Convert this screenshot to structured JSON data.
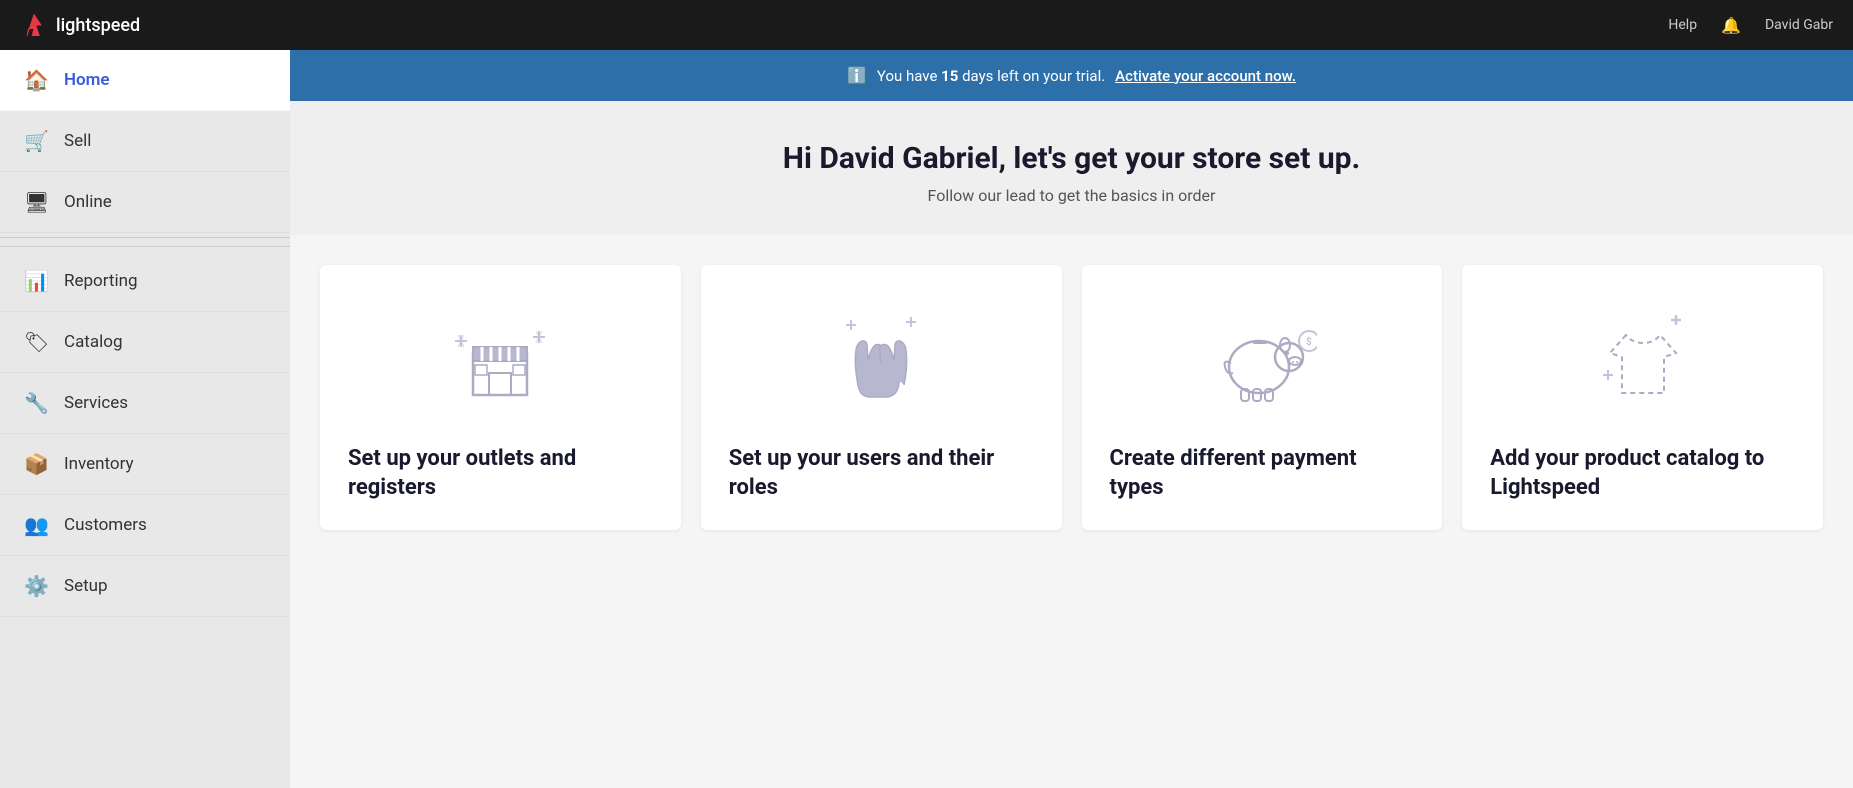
{
  "topbar": {
    "logo_text": "lightspeed",
    "help_label": "Help",
    "user_label": "David Gabr"
  },
  "trial_banner": {
    "message_prefix": "You have ",
    "days": "15",
    "message_suffix": " days left on your trial.",
    "activate_link": "Activate your account now."
  },
  "welcome": {
    "title": "Hi David Gabriel, let's get your store set up.",
    "subtitle": "Follow our lead to get the basics in order"
  },
  "sidebar": {
    "items": [
      {
        "id": "home",
        "label": "Home",
        "icon": "🏠",
        "active": true
      },
      {
        "id": "sell",
        "label": "Sell",
        "icon": "🛒",
        "active": false
      },
      {
        "id": "online",
        "label": "Online",
        "icon": "🖥",
        "active": false
      },
      {
        "id": "reporting",
        "label": "Reporting",
        "icon": "📊",
        "active": false
      },
      {
        "id": "catalog",
        "label": "Catalog",
        "icon": "🏷",
        "active": false
      },
      {
        "id": "services",
        "label": "Services",
        "icon": "🔧",
        "active": false
      },
      {
        "id": "inventory",
        "label": "Inventory",
        "icon": "📦",
        "active": false
      },
      {
        "id": "customers",
        "label": "Customers",
        "icon": "👥",
        "active": false
      },
      {
        "id": "setup",
        "label": "Setup",
        "icon": "⚙️",
        "active": false
      }
    ]
  },
  "cards": [
    {
      "id": "outlets",
      "title": "Set up your outlets and registers"
    },
    {
      "id": "users",
      "title": "Set up your users and their roles"
    },
    {
      "id": "payments",
      "title": "Create different payment types"
    },
    {
      "id": "catalog",
      "title": "Add your product catalog to Lightspeed"
    }
  ]
}
